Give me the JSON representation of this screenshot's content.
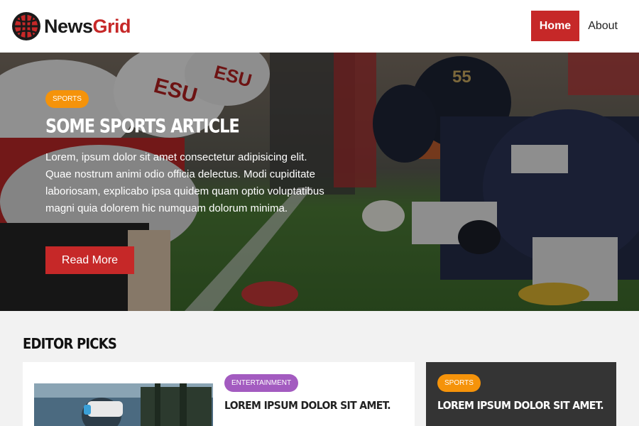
{
  "brand": {
    "name_part1": "News",
    "name_part2": "Grid",
    "accent": "#c62828"
  },
  "nav": {
    "items": [
      {
        "label": "Home",
        "active": true
      },
      {
        "label": "About",
        "active": false
      }
    ]
  },
  "hero": {
    "category": "Sports",
    "title": "Some Sports Article",
    "text": "Lorem, ipsum dolor sit amet consectetur adipisicing elit. Quae nostrum animi odio officia delectus. Modi cupiditate laboriosam, explicabo ipsa quidem quam optio voluptatibus magni quia dolorem hic numquam dolorum minima.",
    "button_label": "Read More",
    "category_color": "#f5930a"
  },
  "editor_picks": {
    "heading": "Editor Picks",
    "cards": [
      {
        "category": "Entertainment",
        "category_color": "#a35bc0",
        "title": "Lorem ipsum dolor sit amet."
      },
      {
        "category": "Sports",
        "category_color": "#f5930a",
        "title": "Lorem ipsum dolor sit amet."
      }
    ]
  },
  "icons": [
    "globe-logo-icon"
  ]
}
